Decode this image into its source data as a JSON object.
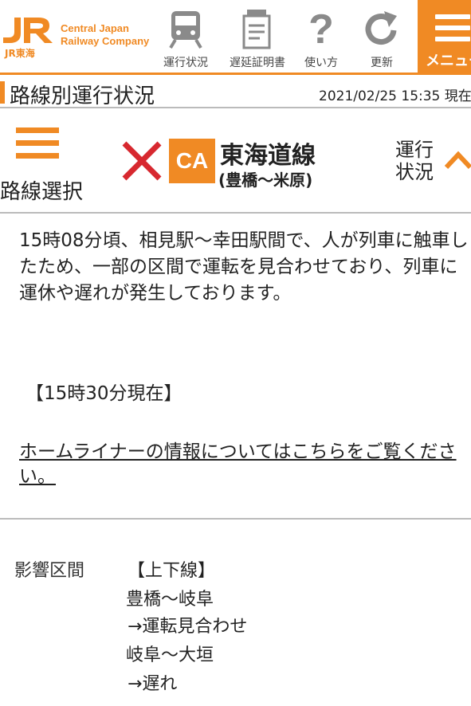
{
  "header": {
    "logo_text": "JR東海",
    "brand_line1": "Central Japan",
    "brand_line2": "Railway Company",
    "nav": [
      {
        "label": "運行状況",
        "icon": "train-icon"
      },
      {
        "label": "遅延証明書",
        "icon": "certificate-icon"
      },
      {
        "label": "使い方",
        "icon": "question-icon"
      },
      {
        "label": "更新",
        "icon": "refresh-icon"
      }
    ],
    "menu_label": "メニュー"
  },
  "titlebar": {
    "title": "路線別運行状況",
    "timestamp": "2021/02/25 15:35 現在"
  },
  "line": {
    "route_select_label": "路線選択",
    "code": "CA",
    "name": "東海道線",
    "range": "(豊橋〜米原)",
    "status_toggle_label": "運行状況",
    "colors": {
      "accent": "#f08a24",
      "x_mark": "#d7282f"
    }
  },
  "message": {
    "body": "15時08分頃、相見駅〜幸田駅間で、人が列車に触車したため、一部の区間で運転を見合わせており、列車に運休や遅れが発生しております。",
    "timestamp_note": "【15時30分現在】",
    "link_text": "ホームライナーの情報についてはこちらをご覧ください。"
  },
  "affected": {
    "label": "影響区間",
    "direction": "【上下線】",
    "sections": [
      {
        "range": "豊橋〜岐阜",
        "status": "→運転見合わせ"
      },
      {
        "range": "岐阜〜大垣",
        "status": "→遅れ"
      }
    ]
  }
}
